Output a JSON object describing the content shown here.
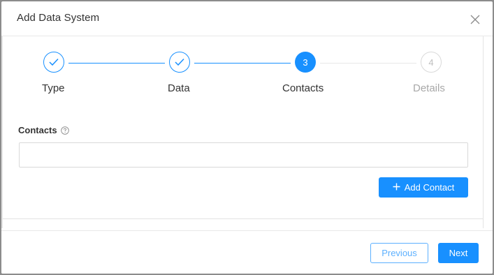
{
  "modal": {
    "title": "Add Data System"
  },
  "stepper": {
    "steps": [
      {
        "label": "Type",
        "status": "done",
        "number": ""
      },
      {
        "label": "Data",
        "status": "done",
        "number": ""
      },
      {
        "label": "Contacts",
        "status": "active",
        "number": "3"
      },
      {
        "label": "Details",
        "status": "todo",
        "number": "4"
      }
    ]
  },
  "contacts": {
    "label": "Contacts",
    "value": "",
    "add_button_label": "Add Contact"
  },
  "footer": {
    "previous_label": "Previous",
    "next_label": "Next"
  },
  "colors": {
    "accent": "#1890ff",
    "inactive": "#d9d9d9"
  }
}
